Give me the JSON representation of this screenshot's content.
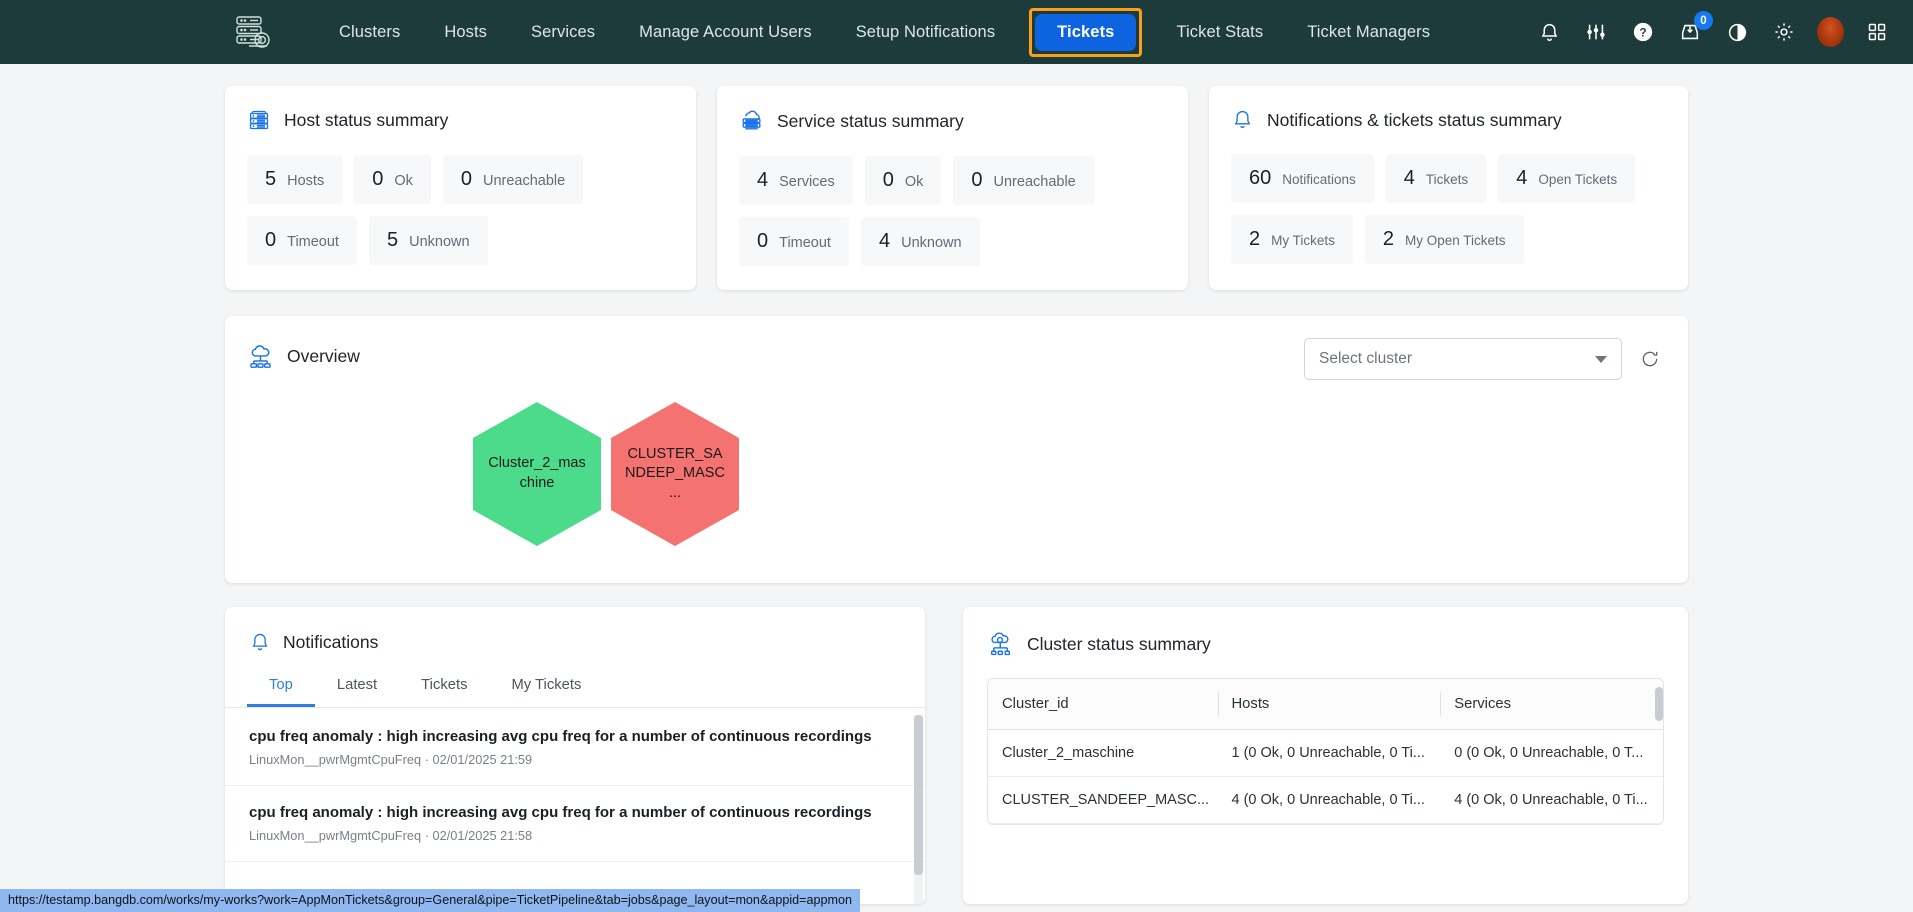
{
  "navbar": {
    "logo_icon": "server-rack-icon",
    "links": [
      {
        "label": "Clusters"
      },
      {
        "label": "Hosts"
      },
      {
        "label": "Services"
      },
      {
        "label": "Manage Account Users"
      },
      {
        "label": "Setup Notifications"
      }
    ],
    "active_link": {
      "label": "Tickets"
    },
    "links_after": [
      {
        "label": "Ticket Stats"
      },
      {
        "label": "Ticket Managers"
      }
    ],
    "icons": [
      {
        "name": "bell-icon"
      },
      {
        "name": "sliders-icon"
      },
      {
        "name": "help-icon"
      },
      {
        "name": "inbox-download-icon",
        "badge": "0"
      },
      {
        "name": "dark-mode-icon"
      },
      {
        "name": "gear-icon"
      },
      {
        "name": "avatar"
      },
      {
        "name": "apps-grid-icon"
      }
    ],
    "colors": {
      "bg": "#1d3b3a",
      "active_bg": "#0d63e0",
      "highlight": "#f7a01b"
    }
  },
  "host_card": {
    "title": "Host status summary",
    "icon": "server-rack-icon",
    "stats": [
      {
        "num": "5",
        "label": "Hosts"
      },
      {
        "num": "0",
        "label": "Ok"
      },
      {
        "num": "0",
        "label": "Unreachable"
      },
      {
        "num": "0",
        "label": "Timeout"
      },
      {
        "num": "5",
        "label": "Unknown"
      }
    ]
  },
  "service_card": {
    "title": "Service status summary",
    "icon": "cloud-server-icon",
    "stats": [
      {
        "num": "4",
        "label": "Services"
      },
      {
        "num": "0",
        "label": "Ok"
      },
      {
        "num": "0",
        "label": "Unreachable"
      },
      {
        "num": "0",
        "label": "Timeout"
      },
      {
        "num": "4",
        "label": "Unknown"
      }
    ]
  },
  "notif_card": {
    "title": "Notifications & tickets status summary",
    "icon": "bell-icon",
    "stats": [
      {
        "num": "60",
        "label": "Notifications"
      },
      {
        "num": "4",
        "label": "Tickets"
      },
      {
        "num": "4",
        "label": "Open Tickets"
      },
      {
        "num": "2",
        "label": "My Tickets"
      },
      {
        "num": "2",
        "label": "My Open Tickets"
      }
    ]
  },
  "overview": {
    "title": "Overview",
    "icon": "cloud-network-icon",
    "select": {
      "value": "Select cluster"
    },
    "refresh_icon": "refresh-icon",
    "hexagons": [
      {
        "label": "Cluster_2_maschine",
        "color": "#4bdb8b"
      },
      {
        "label": "CLUSTER_SANDEEP_MASC ...",
        "color": "#f4726f"
      }
    ]
  },
  "notifications": {
    "title": "Notifications",
    "icon": "bell-icon",
    "tabs": [
      {
        "label": "Top",
        "active": true
      },
      {
        "label": "Latest",
        "active": false
      },
      {
        "label": "Tickets",
        "active": false
      },
      {
        "label": "My Tickets",
        "active": false
      }
    ],
    "items": [
      {
        "title": "cpu freq anomaly : high increasing avg cpu freq for a number of continuous recordings",
        "source": "LinuxMon__pwrMgmtCpuFreq",
        "separator": "·",
        "time": "02/01/2025 21:59"
      },
      {
        "title": "cpu freq anomaly : high increasing avg cpu freq for a number of continuous recordings",
        "source": "LinuxMon__pwrMgmtCpuFreq",
        "separator": "·",
        "time": "02/01/2025 21:58"
      }
    ]
  },
  "cluster_summary": {
    "title": "Cluster status summary",
    "icon": "cloud-cluster-icon",
    "columns": [
      "Cluster_id",
      "Hosts",
      "Services"
    ],
    "rows": [
      {
        "cluster_id": "Cluster_2_maschine",
        "hosts": "1 (0 Ok, 0 Unreachable, 0 Ti...",
        "services": "0 (0 Ok, 0 Unreachable, 0 T..."
      },
      {
        "cluster_id": "CLUSTER_SANDEEP_MASC...",
        "hosts": "4 (0 Ok, 0 Unreachable, 0 Ti...",
        "services": "4 (0 Ok, 0 Unreachable, 0 Ti..."
      }
    ]
  },
  "statusbar": {
    "url": "https://testamp.bangdb.com/works/my-works?work=AppMonTickets&group=General&pipe=TicketPipeline&tab=jobs&page_layout=mon&appid=appmon"
  }
}
